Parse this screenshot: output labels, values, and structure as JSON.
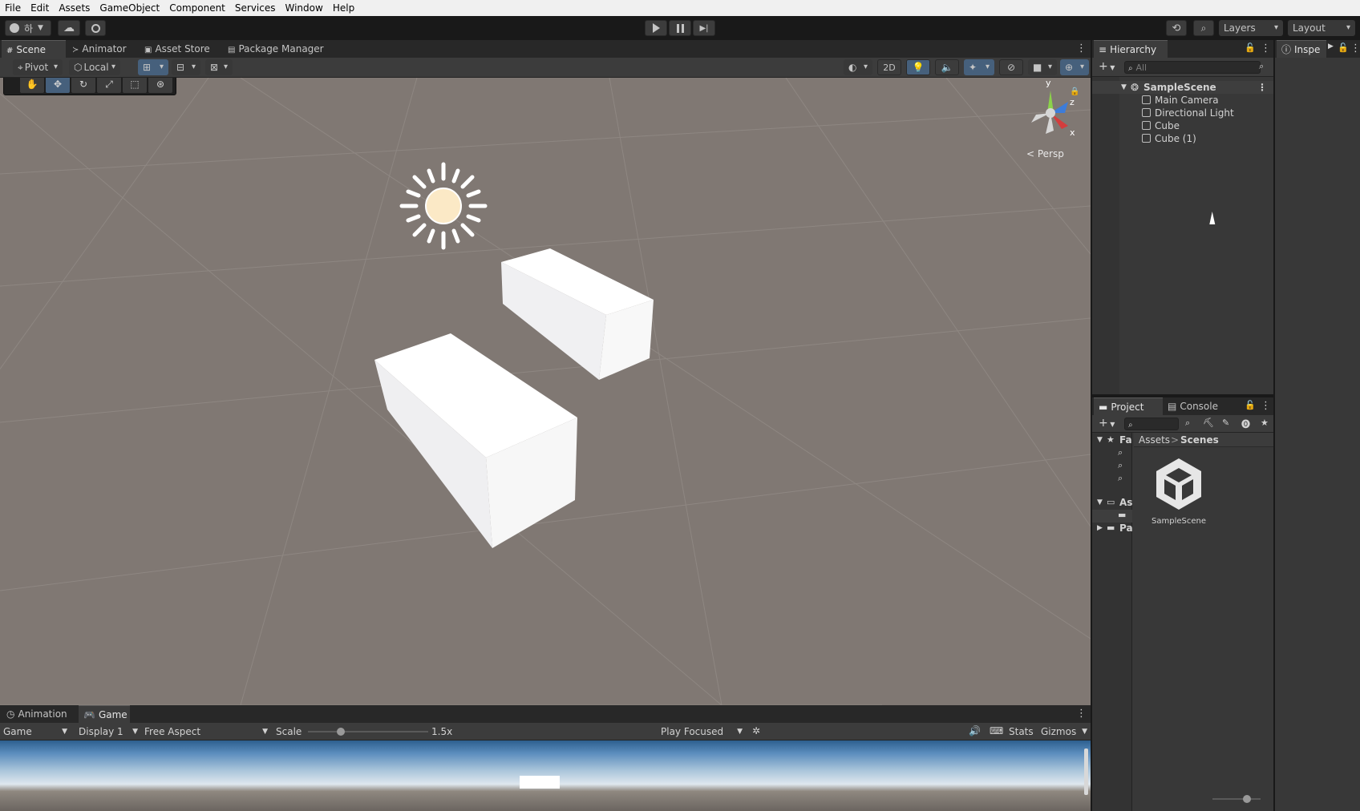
{
  "menu": [
    "File",
    "Edit",
    "Assets",
    "GameObject",
    "Component",
    "Services",
    "Window",
    "Help"
  ],
  "toolbar": {
    "account_label": "하",
    "layers_label": "Layers",
    "layout_label": "Layout"
  },
  "scene_tabs": [
    "Scene",
    "Animator",
    "Asset Store",
    "Package Manager"
  ],
  "scene_toolbar": {
    "pivot_label": "Pivot",
    "local_label": "Local",
    "mode_2d": "2D"
  },
  "gizmo": {
    "y_label": "y",
    "z_label": "z",
    "x_label": "x",
    "persp_label": "< Persp"
  },
  "hierarchy": {
    "tab_label": "Hierarchy",
    "search_placeholder": "All",
    "scene_name": "SampleScene",
    "items": [
      "Main Camera",
      "Directional Light",
      "Cube",
      "Cube (1)"
    ]
  },
  "inspector": {
    "tab_label": "Inspe"
  },
  "project": {
    "tabs": [
      "Project",
      "Console"
    ],
    "breadcrumb_root": "Assets",
    "breadcrumb_separator": ">",
    "breadcrumb_current": "Scenes",
    "tree": [
      "Fa",
      "As",
      "Pa"
    ],
    "asset_name": "SampleScene"
  },
  "bottom_tabs": [
    "Animation",
    "Game"
  ],
  "game_toolbar": {
    "view_label": "Game",
    "display_label": "Display 1",
    "aspect_label": "Free Aspect",
    "scale_label": "Scale",
    "scale_value": "1.5x",
    "play_focused_label": "Play Focused",
    "stats_label": "Stats",
    "gizmos_label": "Gizmos"
  },
  "colors": {
    "scene_bg": "#807873",
    "panel_bg": "#383838",
    "accent": "#46607c"
  }
}
